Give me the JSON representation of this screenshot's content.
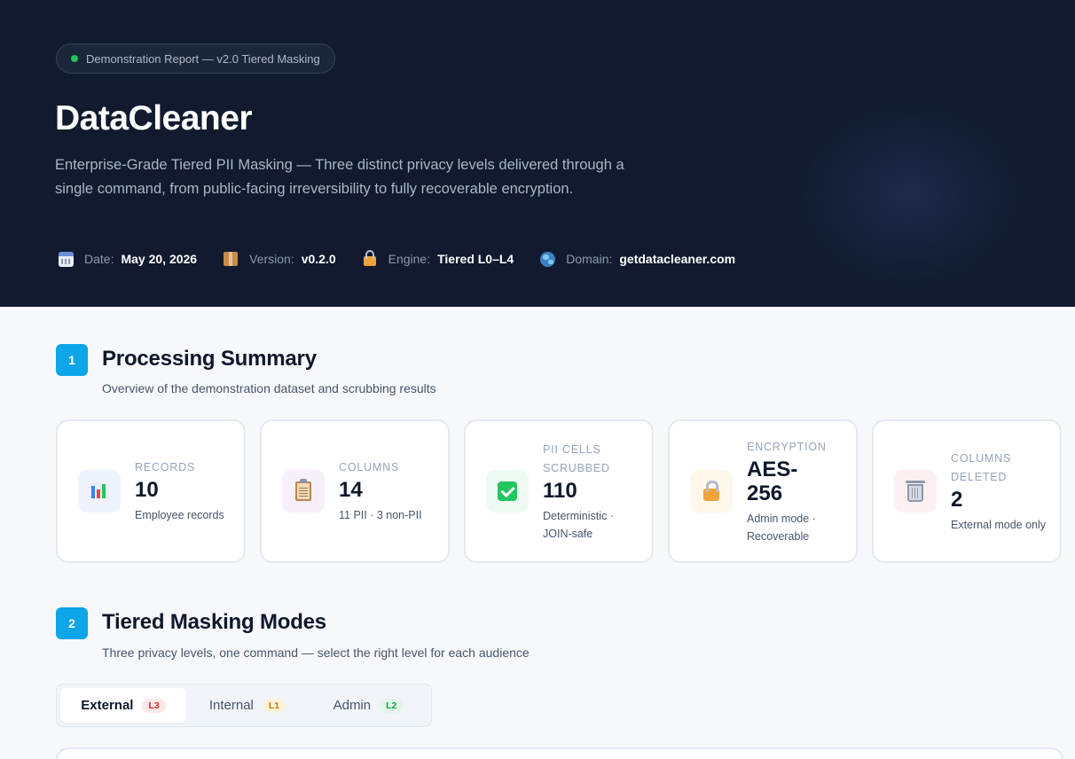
{
  "hero": {
    "badge": "Demonstration Report — v2.0 Tiered Masking",
    "title": "DataCleaner",
    "subtitle": "Enterprise-Grade Tiered PII Masking — Three distinct privacy levels delivered through a single command, from public-facing irreversibility to fully recoverable encryption.",
    "meta": [
      {
        "icon": "calendar-icon",
        "label": "Date:",
        "value": "May 20, 2026"
      },
      {
        "icon": "package-icon",
        "label": "Version:",
        "value": "v0.2.0"
      },
      {
        "icon": "lock-key-icon",
        "label": "Engine:",
        "value": "Tiered L0–L4"
      },
      {
        "icon": "globe-icon",
        "label": "Domain:",
        "value": "getdatacleaner.com"
      }
    ]
  },
  "summary": {
    "number": "1",
    "title": "Processing Summary",
    "description": "Overview of the demonstration dataset and scrubbing results",
    "cards": [
      {
        "icon": "bar-chart-icon",
        "label": "Records",
        "value": "10",
        "note": "Employee records",
        "tint": "#eef3fd"
      },
      {
        "icon": "clipboard-icon",
        "label": "Columns",
        "value": "14",
        "note": "11 PII · 3 non-PII",
        "tint": "#f7f0fa"
      },
      {
        "icon": "check-box-icon",
        "label": "PII Cells Scrubbed",
        "value": "110",
        "note": "Deterministic · JOIN-safe",
        "tint": "#ecfaf1"
      },
      {
        "icon": "lock-icon",
        "label": "Encryption",
        "value": "AES-256",
        "note": "Admin mode · Recoverable",
        "tint": "#fdf8e9"
      },
      {
        "icon": "trash-icon",
        "label": "Columns Deleted",
        "value": "2",
        "note": "External mode only",
        "tint": "#fdf0f0"
      }
    ]
  },
  "modes": {
    "number": "2",
    "title": "Tiered Masking Modes",
    "description": "Three privacy levels, one command — select the right level for each audience",
    "tabs": [
      {
        "label": "External",
        "level": "L3",
        "pill_bg": "#fde8e8",
        "pill_fg": "#dc2626",
        "active": true
      },
      {
        "label": "Internal",
        "level": "L1",
        "pill_bg": "#fdf3dc",
        "pill_fg": "#d97706",
        "active": false
      },
      {
        "label": "Admin",
        "level": "L2",
        "pill_bg": "#e3f6ea",
        "pill_fg": "#16a34a",
        "active": false
      }
    ]
  },
  "colors": {
    "accent": "#0ea5e9",
    "hero_bg": "#111a2e",
    "status_dot": "#22c55e"
  }
}
